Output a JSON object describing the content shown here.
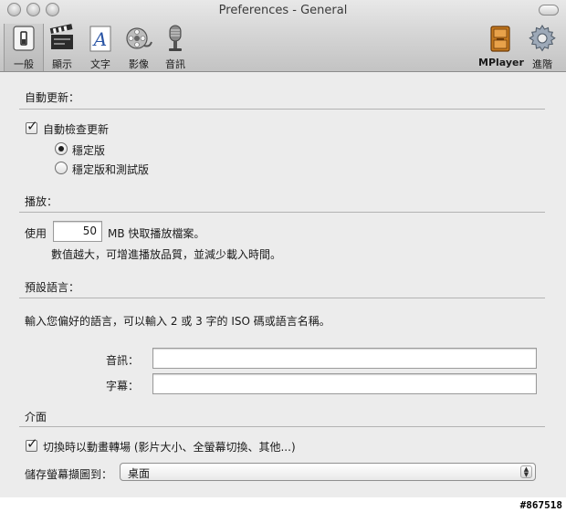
{
  "window": {
    "title": "Preferences - General"
  },
  "toolbar": {
    "items": [
      {
        "label": "一般",
        "icon": "switch-icon",
        "selected": true
      },
      {
        "label": "顯示",
        "icon": "clapperboard-icon"
      },
      {
        "label": "文字",
        "icon": "text-icon"
      },
      {
        "label": "影像",
        "icon": "film-reel-icon"
      },
      {
        "label": "音訊",
        "icon": "microphone-icon"
      },
      {
        "label": "MPlayer",
        "icon": "mplayer-icon"
      },
      {
        "label": "進階",
        "icon": "gear-icon"
      }
    ]
  },
  "updates": {
    "section_title": "自動更新：",
    "auto_check_label": "自動檢查更新",
    "auto_check_checked": true,
    "stable_label": "穩定版",
    "beta_label": "穩定版和測試版",
    "selected": "stable"
  },
  "playback": {
    "section_title": "播放：",
    "use_label": "使用",
    "cache_value": "50",
    "cache_unit_label": "MB 快取播放檔案。",
    "hint": "數值越大，可增進播放品質，並減少載入時間。"
  },
  "language": {
    "section_title": "預設語言：",
    "description": "輸入您偏好的語言，可以輸入 2 或 3 字的 ISO 碼或語言名稱。",
    "audio_label": "音訊：",
    "audio_value": "",
    "subtitle_label": "字幕：",
    "subtitle_value": ""
  },
  "interface": {
    "section_title": "介面",
    "animate_label": "切換時以動畫轉場 (影片大小、全螢幕切換、其他...)",
    "animate_checked": true,
    "screenshot_label": "儲存螢幕擷圖到：",
    "screenshot_value": "桌面"
  },
  "watermark": "#867518"
}
